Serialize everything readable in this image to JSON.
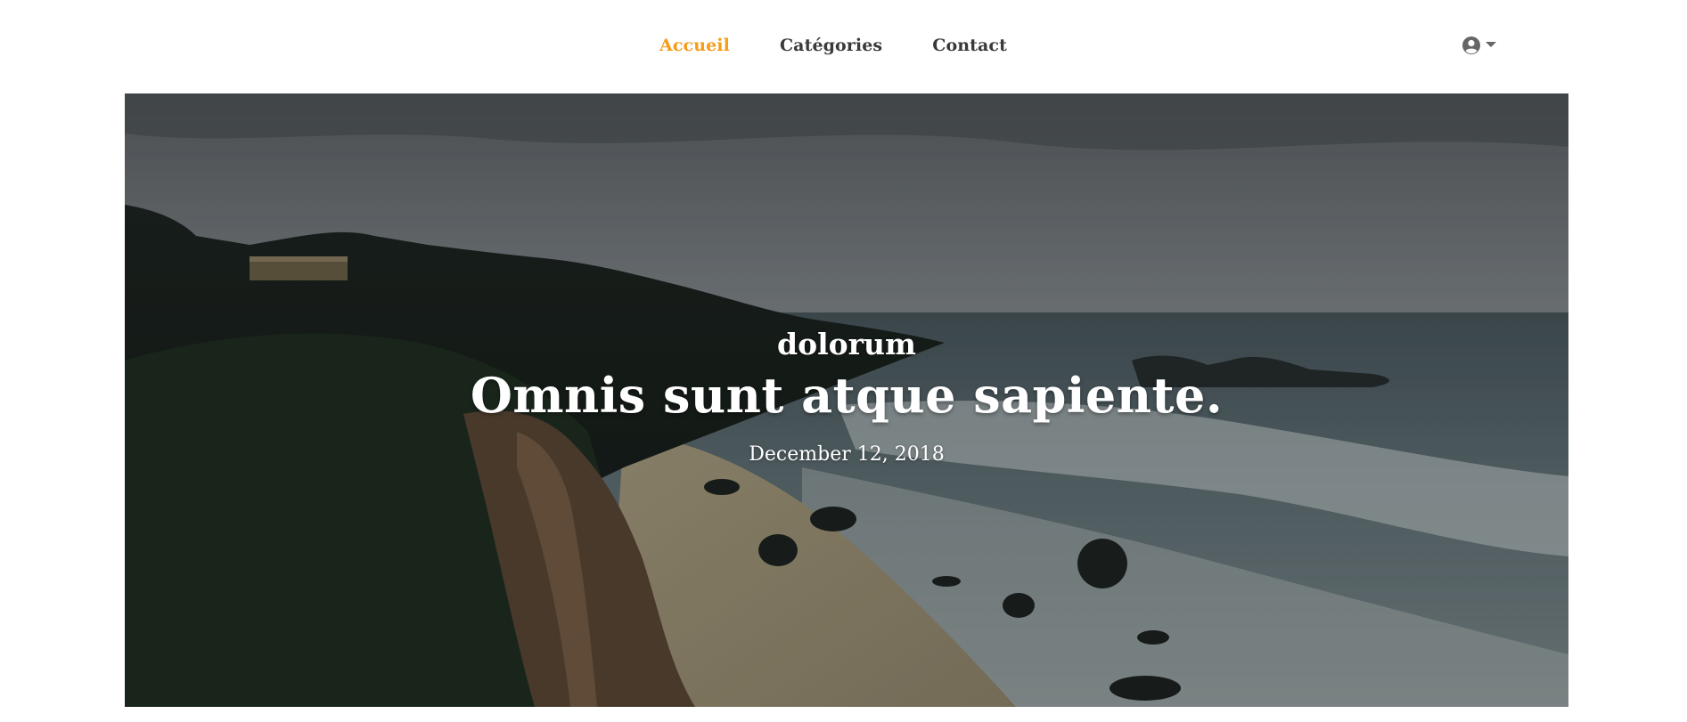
{
  "nav": {
    "items": [
      {
        "label": "Accueil",
        "active": true
      },
      {
        "label": "Catégories",
        "active": false
      },
      {
        "label": "Contact",
        "active": false
      }
    ],
    "user_icon": "user-circle-icon",
    "caret_icon": "caret-down-icon"
  },
  "hero": {
    "category": "dolorum",
    "title": "Omnis sunt atque sapiente.",
    "date": "December 12, 2018"
  },
  "colors": {
    "accent": "#f59c1a",
    "nav_text": "#3a3a3a",
    "icon": "#666666"
  }
}
